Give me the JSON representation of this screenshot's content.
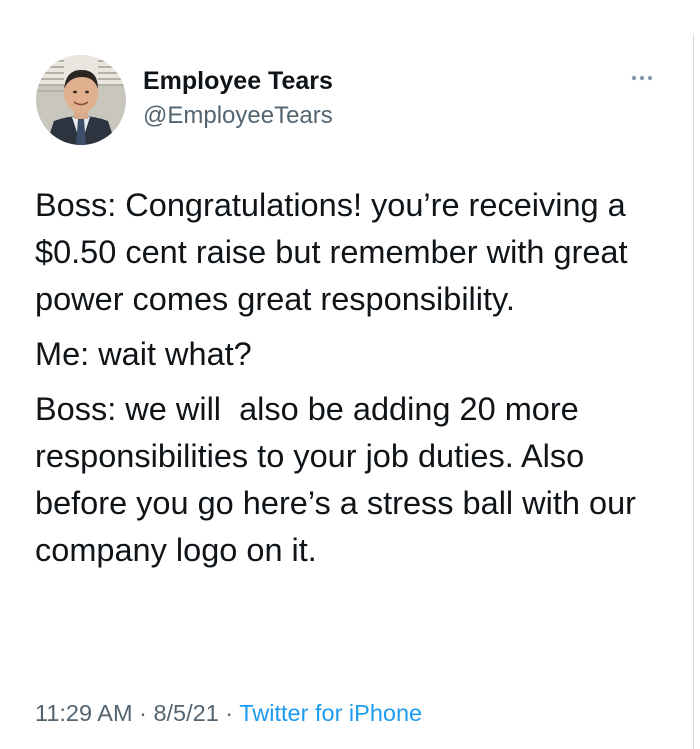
{
  "tweet": {
    "author": {
      "display_name": "Employee Tears",
      "handle": "@EmployeeTears",
      "avatar_icon": "profile-photo"
    },
    "more_icon": "more-dots-icon",
    "paragraphs": [
      "Boss: Congratulations! you’re receiving a $0.50 cent raise but remember with great power comes great responsibility.",
      "Me: wait what?",
      "Boss: we will  also be adding 20 more responsibilities to your job duties. Also before you go here’s a stress ball with our company logo on it."
    ],
    "meta": {
      "time": "11:29 AM",
      "separator": " · ",
      "date": "8/5/21",
      "source": "Twitter for iPhone"
    }
  },
  "colors": {
    "text_primary": "#0f1419",
    "text_secondary": "#536471",
    "link": "#1d9bf0"
  }
}
